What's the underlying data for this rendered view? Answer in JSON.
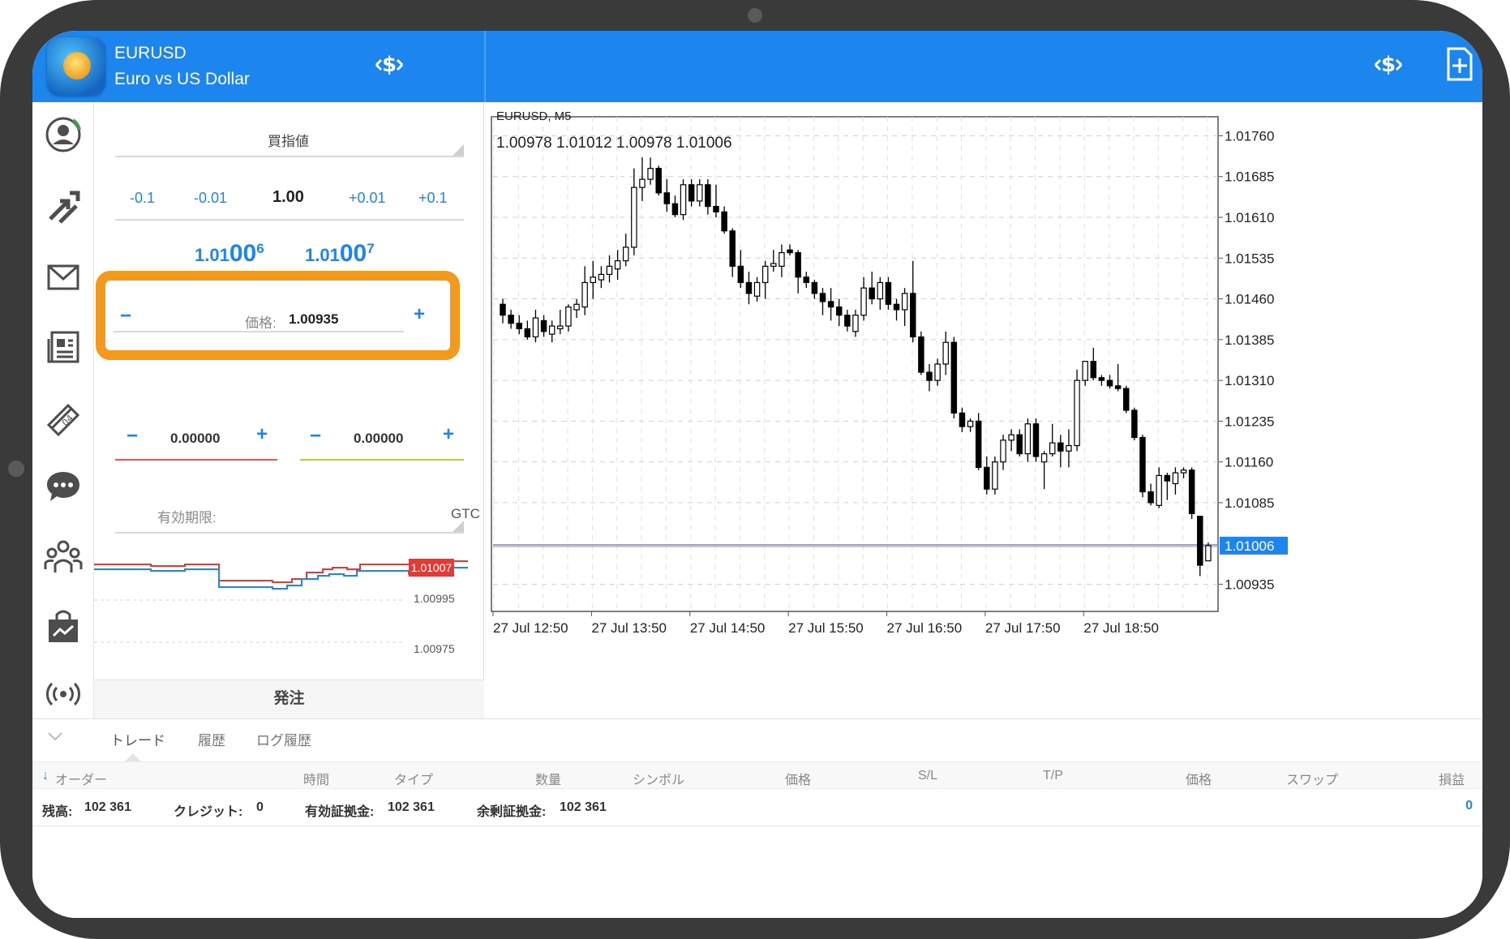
{
  "header": {
    "symbol": "EURUSD",
    "description": "Euro vs US Dollar"
  },
  "order_panel": {
    "order_type": "買指値",
    "lot_steps": [
      "-0.1",
      "-0.01",
      "+0.01",
      "+0.1"
    ],
    "lot_value": "1.00",
    "bid": {
      "prefix": "1.01",
      "big": "00",
      "sup": "6"
    },
    "ask": {
      "prefix": "1.01",
      "big": "00",
      "sup": "7"
    },
    "price_label": "価格:",
    "price_value": "1.00935",
    "stop_loss": "0.00000",
    "take_profit": "0.00000",
    "expiry_label": "有効期限:",
    "expiry_value": "GTC",
    "mini_chart_prices": [
      "1.01007",
      "1.00995",
      "1.00975"
    ],
    "order_button": "発注",
    "minus": "−",
    "plus": "+"
  },
  "chart": {
    "title": "EURUSD, M5",
    "ohlc_readout": "1.00978 1.01012 1.00978 1.01006",
    "current_price": "1.01006",
    "current_price_color": "#1c86ee",
    "bullish_color": "#ffffff",
    "bearish_color": "#000000"
  },
  "chart_data": {
    "type": "candlestick",
    "title": "EURUSD, M5",
    "ylim": [
      1.00885,
      1.01795
    ],
    "y_ticks": [
      "1.01760",
      "1.01685",
      "1.01610",
      "1.01535",
      "1.01460",
      "1.01385",
      "1.01310",
      "1.01235",
      "1.01160",
      "1.01085",
      "1.01006",
      "1.00935"
    ],
    "x_ticks": [
      "27 Jul 12:50",
      "27 Jul 13:50",
      "27 Jul 14:50",
      "27 Jul 15:50",
      "27 Jul 16:50",
      "27 Jul 17:50",
      "27 Jul 18:50"
    ],
    "current_price": 1.01006,
    "grid": true,
    "candles": [
      [
        1.0145,
        1.0146,
        1.01415,
        1.0143
      ],
      [
        1.0143,
        1.0144,
        1.01405,
        1.01415
      ],
      [
        1.01415,
        1.0143,
        1.01395,
        1.01405
      ],
      [
        1.01405,
        1.0142,
        1.01385,
        1.0139
      ],
      [
        1.0139,
        1.0144,
        1.0138,
        1.01425
      ],
      [
        1.0142,
        1.0143,
        1.0139,
        1.014
      ],
      [
        1.01395,
        1.0142,
        1.0138,
        1.0141
      ],
      [
        1.01405,
        1.0144,
        1.01395,
        1.0141
      ],
      [
        1.0141,
        1.0145,
        1.014,
        1.01445
      ],
      [
        1.0144,
        1.0146,
        1.01425,
        1.0145
      ],
      [
        1.01445,
        1.0152,
        1.0143,
        1.0149
      ],
      [
        1.0149,
        1.0153,
        1.0146,
        1.015
      ],
      [
        1.01495,
        1.0152,
        1.0148,
        1.01505
      ],
      [
        1.01505,
        1.0154,
        1.0149,
        1.0152
      ],
      [
        1.01515,
        1.0155,
        1.01495,
        1.0153
      ],
      [
        1.0153,
        1.0158,
        1.0152,
        1.01555
      ],
      [
        1.01555,
        1.017,
        1.0154,
        1.01665
      ],
      [
        1.01665,
        1.0172,
        1.0164,
        1.0168
      ],
      [
        1.0168,
        1.0172,
        1.0167,
        1.017
      ],
      [
        1.017,
        1.01705,
        1.0165,
        1.01655
      ],
      [
        1.01655,
        1.0168,
        1.0162,
        1.01635
      ],
      [
        1.01635,
        1.0165,
        1.0161,
        1.01615
      ],
      [
        1.01615,
        1.0168,
        1.01605,
        1.0167
      ],
      [
        1.0167,
        1.0168,
        1.0163,
        1.0164
      ],
      [
        1.0164,
        1.0168,
        1.0163,
        1.0167
      ],
      [
        1.0167,
        1.0168,
        1.01615,
        1.0163
      ],
      [
        1.0163,
        1.0167,
        1.0161,
        1.0162
      ],
      [
        1.0162,
        1.0163,
        1.0158,
        1.01585
      ],
      [
        1.01585,
        1.0159,
        1.015,
        1.0152
      ],
      [
        1.0152,
        1.0155,
        1.0148,
        1.0149
      ],
      [
        1.0149,
        1.0151,
        1.0145,
        1.0147
      ],
      [
        1.01465,
        1.015,
        1.01455,
        1.0149
      ],
      [
        1.0149,
        1.0153,
        1.0146,
        1.0152
      ],
      [
        1.0152,
        1.0155,
        1.0151,
        1.01525
      ],
      [
        1.0152,
        1.0156,
        1.015,
        1.01545
      ],
      [
        1.0155,
        1.0156,
        1.0154,
        1.01545
      ],
      [
        1.01545,
        1.0155,
        1.0147,
        1.015
      ],
      [
        1.015,
        1.0151,
        1.0148,
        1.0149
      ],
      [
        1.0149,
        1.01495,
        1.0146,
        1.0147
      ],
      [
        1.0147,
        1.0148,
        1.0143,
        1.01455
      ],
      [
        1.01455,
        1.0148,
        1.0142,
        1.01445
      ],
      [
        1.01445,
        1.0146,
        1.0141,
        1.0143
      ],
      [
        1.0143,
        1.0144,
        1.014,
        1.0141
      ],
      [
        1.014,
        1.0144,
        1.0139,
        1.0143
      ],
      [
        1.0143,
        1.015,
        1.0142,
        1.0148
      ],
      [
        1.0148,
        1.0151,
        1.0145,
        1.0146
      ],
      [
        1.0146,
        1.015,
        1.0144,
        1.0149
      ],
      [
        1.0149,
        1.015,
        1.0144,
        1.0145
      ],
      [
        1.0145,
        1.0146,
        1.0142,
        1.0144
      ],
      [
        1.0144,
        1.0148,
        1.0141,
        1.0147
      ],
      [
        1.0147,
        1.0153,
        1.0138,
        1.0139
      ],
      [
        1.0139,
        1.014,
        1.0132,
        1.01325
      ],
      [
        1.01325,
        1.0134,
        1.0129,
        1.0131
      ],
      [
        1.0131,
        1.0135,
        1.013,
        1.0134
      ],
      [
        1.0134,
        1.014,
        1.0132,
        1.0138
      ],
      [
        1.0138,
        1.0139,
        1.0124,
        1.0125
      ],
      [
        1.0125,
        1.0126,
        1.01215,
        1.01225
      ],
      [
        1.01225,
        1.0124,
        1.01215,
        1.01235
      ],
      [
        1.01235,
        1.0125,
        1.01145,
        1.0115
      ],
      [
        1.0115,
        1.0117,
        1.011,
        1.0111
      ],
      [
        1.0111,
        1.0117,
        1.011,
        1.0116
      ],
      [
        1.0116,
        1.0121,
        1.01145,
        1.012
      ],
      [
        1.012,
        1.0122,
        1.0118,
        1.0121
      ],
      [
        1.0121,
        1.0122,
        1.0117,
        1.01175
      ],
      [
        1.01175,
        1.0124,
        1.0116,
        1.0123
      ],
      [
        1.0123,
        1.0124,
        1.0116,
        1.0117
      ],
      [
        1.0116,
        1.0118,
        1.0111,
        1.01175
      ],
      [
        1.01175,
        1.0123,
        1.0117,
        1.01195
      ],
      [
        1.01195,
        1.0121,
        1.0115,
        1.0118
      ],
      [
        1.0118,
        1.0122,
        1.0115,
        1.0119
      ],
      [
        1.0119,
        1.0133,
        1.0118,
        1.0131
      ],
      [
        1.0131,
        1.01345,
        1.013,
        1.01345
      ],
      [
        1.01345,
        1.0137,
        1.0131,
        1.01315
      ],
      [
        1.01315,
        1.0132,
        1.013,
        1.0131
      ],
      [
        1.0131,
        1.0132,
        1.01295,
        1.013
      ],
      [
        1.013,
        1.0134,
        1.0129,
        1.01295
      ],
      [
        1.01295,
        1.013,
        1.0125,
        1.01255
      ],
      [
        1.01255,
        1.0126,
        1.012,
        1.01205
      ],
      [
        1.01205,
        1.0121,
        1.01095,
        1.01105
      ],
      [
        1.01105,
        1.0112,
        1.0108,
        1.01085
      ],
      [
        1.0108,
        1.0115,
        1.01075,
        1.01135
      ],
      [
        1.01135,
        1.0114,
        1.0109,
        1.01125
      ],
      [
        1.0112,
        1.0115,
        1.011,
        1.0114
      ],
      [
        1.0114,
        1.0115,
        1.0113,
        1.01145
      ],
      [
        1.01145,
        1.0115,
        1.01055,
        1.01065
      ],
      [
        1.0106,
        1.0101,
        1.0095,
        1.0097
      ],
      [
        1.00978,
        1.01012,
        1.00978,
        1.01006
      ]
    ]
  },
  "terminal": {
    "tabs": [
      "トレード",
      "履歴",
      "ログ履歴"
    ],
    "columns": [
      "オーダー",
      "時間",
      "タイプ",
      "数量",
      "シンボル",
      "価格",
      "S/L",
      "T/P",
      "価格",
      "スワップ",
      "損益"
    ],
    "summary": {
      "balance_label": "残高:",
      "balance": "102 361",
      "credit_label": "クレジット:",
      "credit": "0",
      "equity_label": "有効証拠金:",
      "equity": "102 361",
      "free_margin_label": "余剰証拠金:",
      "free_margin": "102 361",
      "profit": "0"
    }
  },
  "icons": {
    "nav": [
      "account-icon",
      "trade-arrows-icon",
      "mail-icon",
      "news-icon",
      "calendar-icon",
      "chat-icon",
      "community-icon",
      "market-icon",
      "signals-icon"
    ],
    "header": [
      "quotes-dollar-icon",
      "new-order-icon"
    ]
  }
}
